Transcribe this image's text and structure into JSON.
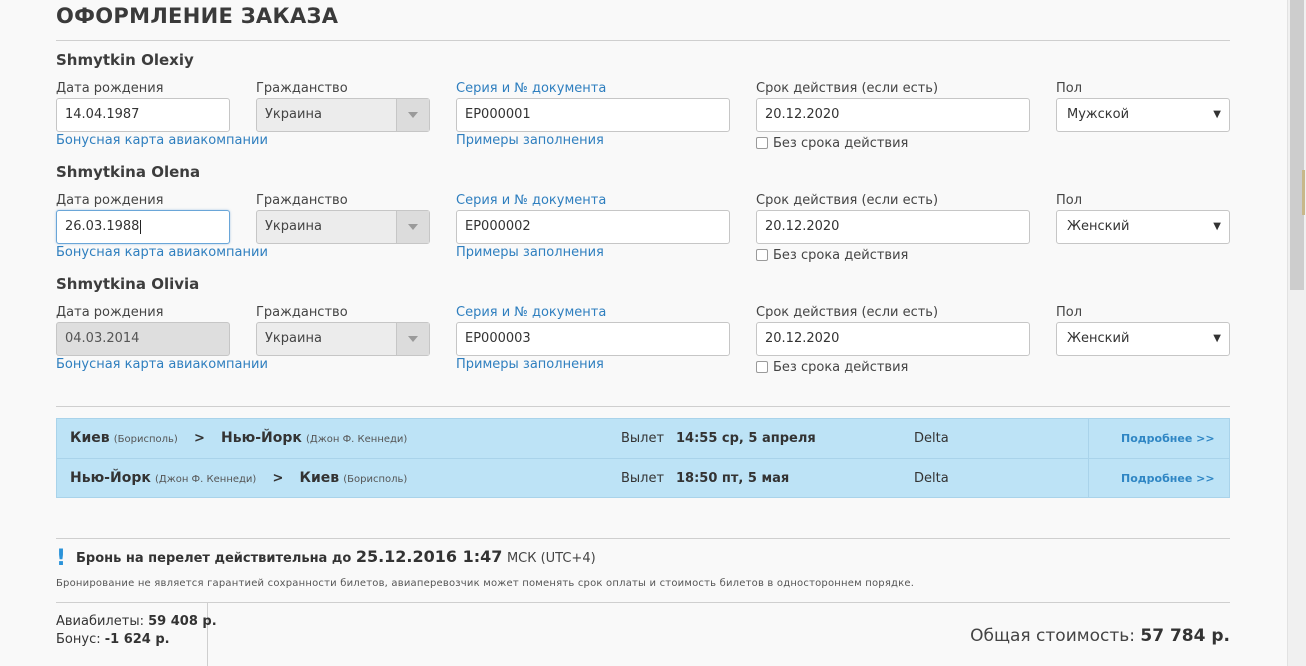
{
  "page": {
    "title": "ОФОРМЛЕНИЕ ЗАКАЗА"
  },
  "labels": {
    "dob": "Дата рождения",
    "citizenship": "Гражданство",
    "doc": "Серия и № документа",
    "expiry": "Срок действия (если есть)",
    "sex": "Пол",
    "bonus_link": "Бонусная карта авиакомпании",
    "examples_link": "Примеры заполнения",
    "no_expiry": "Без срока действия"
  },
  "passengers": [
    {
      "name": "Shmytkin Olexiy",
      "dob": "14.04.1987",
      "citizenship": "Украина",
      "doc": "ЕР000001",
      "expiry": "20.12.2020",
      "sex": "Мужской"
    },
    {
      "name": "Shmytkina Olena",
      "dob": "26.03.1988",
      "citizenship": "Украина",
      "doc": "ЕР000002",
      "expiry": "20.12.2020",
      "sex": "Женский"
    },
    {
      "name": "Shmytkina Olivia",
      "dob": "04.03.2014",
      "citizenship": "Украина",
      "doc": "ЕР000003",
      "expiry": "20.12.2020",
      "sex": "Женский"
    }
  ],
  "flights": [
    {
      "from_city": "Киев",
      "from_airport": "(Борисполь)",
      "arrow": ">",
      "to_city": "Нью-Йорк",
      "to_airport": "(Джон Ф. Кеннеди)",
      "depart_label": "Вылет",
      "time": "14:55 ср, 5 апреля",
      "airline": "Delta",
      "more": "Подробнее >>"
    },
    {
      "from_city": "Нью-Йорк",
      "from_airport": "(Джон Ф. Кеннеди)",
      "arrow": ">",
      "to_city": "Киев",
      "to_airport": "(Борисполь)",
      "depart_label": "Вылет",
      "time": "18:50 пт, 5 мая",
      "airline": "Delta",
      "more": "Подробнее >>"
    }
  ],
  "booking": {
    "notice_text": "Бронь на перелет действительна до",
    "notice_date": "25.12.2016 1:47",
    "notice_tz": "МСК (UTC+4)",
    "disclaimer": "Бронирование не является гарантией сохранности билетов, авиаперевозчик может поменять срок оплаты и стоимость билетов в одностороннем порядке."
  },
  "summary": {
    "tickets_label": "Авиабилеты:",
    "tickets_value": "59 408 р.",
    "bonus_label": "Бонус:",
    "bonus_value": "-1 624 р.",
    "total_label": "Общая стоимость:",
    "total_value": "57 784 р."
  },
  "colors": {
    "accent_link": "#2f7fbf",
    "flights_bg": "#bde3f6",
    "notice_icon": "#2b93d9"
  }
}
